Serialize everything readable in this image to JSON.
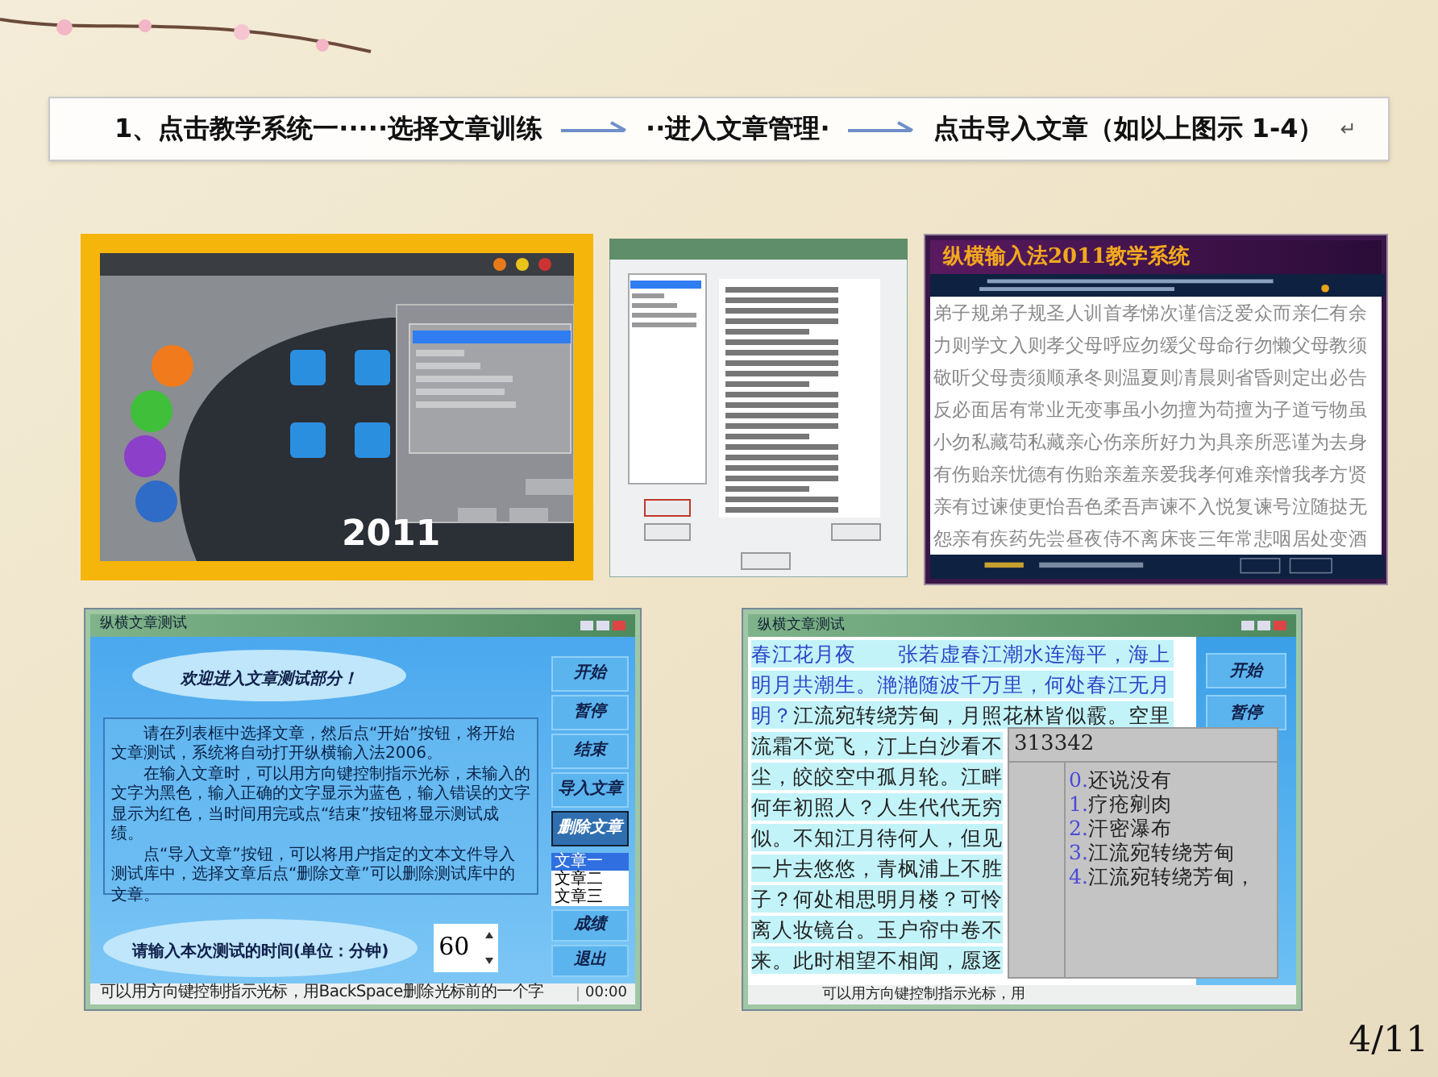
{
  "caption": {
    "steps": [
      "1、点击教学系统一·····选择文章训练",
      "··进入文章管理·",
      "点击导入文章（如以上图示 1-4）"
    ],
    "return_mark": "↵"
  },
  "panel_1": {
    "year": "2011"
  },
  "panel_3": {
    "title": "纵横输入法2011教学系统",
    "lines": [
      "弟子规弟子规圣人训首孝悌次谨信泛爱众而亲仁有余",
      "力则学文入则孝父母呼应勿缓父母命行勿懒父母教须",
      "敬听父母责须顺承冬则温夏则凊晨则省昏则定出必告",
      "反必面居有常业无变事虽小勿擅为苟擅为子道亏物虽",
      "小勿私藏苟私藏亲心伤亲所好力为具亲所恶谨为去身",
      "有伤贻亲忧德有伤贻亲羞亲爱我孝何难亲憎我孝方贤",
      "亲有过谏使更怡吾色柔吾声谏不入悦复谏号泣随挞无",
      "怨亲有疾药先尝昼夜侍不离床丧三年常悲咽居处变酒"
    ]
  },
  "panel_4": {
    "window_title": "纵横文章测试",
    "heading": "欢迎进入文章测试部分！",
    "instructions": [
      "请在列表框中选择文章，然后点“开始”按钮，将开始文章测试，系统将自动打开纵横输入法2006。",
      "在输入文章时，可以用方向键控制指示光标，未输入的文字为黑色，输入正确的文字显示为蓝色，输入错误的文字显示为红色，当时间用完或点“结束”按钮将显示测试成绩。",
      "点“导入文章”按钮，可以将用户指定的文本文件导入测试库中，选择文章后点“删除文章”可以删除测试库中的文章。"
    ],
    "buttons": [
      {
        "label": "开始",
        "highlighted": false
      },
      {
        "label": "暂停",
        "highlighted": false
      },
      {
        "label": "结束",
        "highlighted": false
      },
      {
        "label": "导入文章",
        "highlighted": false
      },
      {
        "label": "删除文章",
        "highlighted": true
      }
    ],
    "article_list": [
      {
        "label": "文章一",
        "selected": true
      },
      {
        "label": "文章二",
        "selected": false
      },
      {
        "label": "文章三",
        "selected": false
      }
    ],
    "time_prompt": "请输入本次测试的时间(单位：分钟)",
    "time_value": "60",
    "bottom_buttons": [
      "成绩",
      "退出"
    ],
    "status": "可以用方向键控制指示光标，用BackSpace删除光标前的一个字",
    "timer": "00:00"
  },
  "panel_5": {
    "window_title": "纵横文章测试",
    "lines": [
      {
        "typed": "春江花月夜　　张若虚春江潮水连海平，海上"
      },
      {
        "typed": "明月共潮生。滟滟随波千万里，何处春江无月"
      },
      {
        "typed": "明？",
        "untyped": "江流宛转绕芳甸，月照花林皆似霰。空里"
      },
      {
        "untyped": "流霜不觉飞，汀上白沙看不"
      },
      {
        "untyped": "尘，皎皎空中孤月轮。江畔"
      },
      {
        "untyped": "何年初照人？人生代代无穷"
      },
      {
        "untyped": "似。不知江月待何人，但见"
      },
      {
        "untyped": "一片去悠悠，青枫浦上不胜"
      },
      {
        "untyped": "子？何处相思明月楼？可怜"
      },
      {
        "untyped": "离人妆镜台。玉户帘中卷不"
      },
      {
        "untyped": "来。此时相望不相闻，愿逐"
      }
    ],
    "buttons": [
      "开始",
      "暂停"
    ],
    "status": "可以用方向键控制指示光标，用",
    "candidate_window": {
      "code": "313342",
      "candidates": [
        {
          "index": "0.",
          "text": "还说没有"
        },
        {
          "index": "1.",
          "text": "疗疮剜肉"
        },
        {
          "index": "2.",
          "text": "汗密瀑布"
        },
        {
          "index": "3.",
          "text": "江流宛转绕芳甸"
        },
        {
          "index": "4.",
          "text": "江流宛转绕芳甸，"
        }
      ]
    }
  },
  "page_number": "4/11"
}
